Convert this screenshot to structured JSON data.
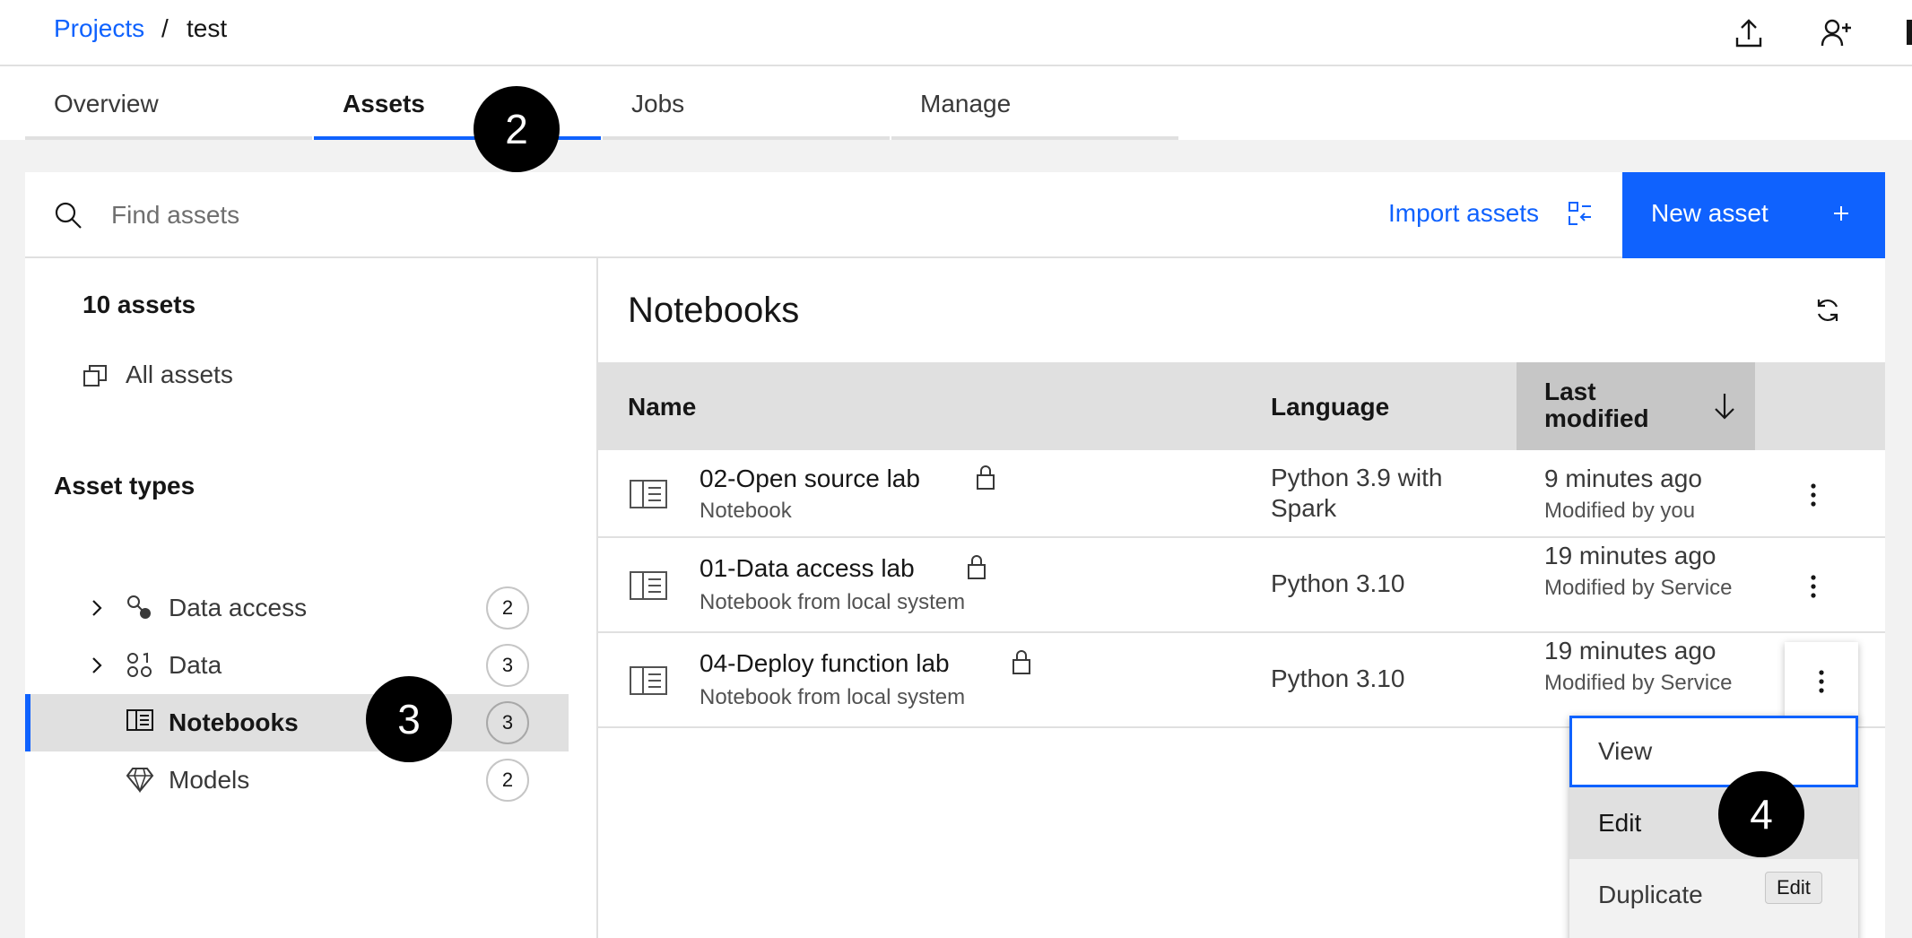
{
  "breadcrumb": {
    "root": "Projects",
    "separator": "/",
    "current": "test"
  },
  "header_icons": [
    "upload-icon",
    "add-user-icon"
  ],
  "tabs": [
    {
      "label": "Overview",
      "active": false
    },
    {
      "label": "Assets",
      "active": true
    },
    {
      "label": "Jobs",
      "active": false
    },
    {
      "label": "Manage",
      "active": false
    }
  ],
  "search": {
    "placeholder": "Find assets",
    "value": ""
  },
  "toolbar": {
    "import_label": "Import assets",
    "new_asset_label": "New asset"
  },
  "sidebar": {
    "count_label": "10 assets",
    "all_assets_label": "All assets",
    "asset_types_title": "Asset types",
    "types": [
      {
        "label": "Data access",
        "count": "2",
        "icon": "data-access-icon",
        "expandable": true,
        "selected": false
      },
      {
        "label": "Data",
        "count": "3",
        "icon": "data-icon",
        "expandable": true,
        "selected": false
      },
      {
        "label": "Notebooks",
        "count": "3",
        "icon": "notebook-icon",
        "expandable": false,
        "selected": true
      },
      {
        "label": "Models",
        "count": "2",
        "icon": "model-icon",
        "expandable": false,
        "selected": false
      }
    ]
  },
  "main": {
    "title": "Notebooks",
    "columns": {
      "name": "Name",
      "language": "Language",
      "modified": "Last modified"
    },
    "sort": {
      "column": "modified",
      "direction": "descending"
    },
    "rows": [
      {
        "name": "02-Open source lab",
        "sub": "Notebook",
        "language": "Python 3.9 with Spark",
        "time": "9 minutes ago",
        "by": "Modified by you"
      },
      {
        "name": "01-Data access lab",
        "sub": "Notebook from local system",
        "language": "Python 3.10",
        "time": "19 minutes ago",
        "by": "Modified by Service"
      },
      {
        "name": "04-Deploy function lab",
        "sub": "Notebook from local system",
        "language": "Python 3.10",
        "time": "19 minutes ago",
        "by": "Modified by Service"
      }
    ]
  },
  "menu": {
    "items": [
      "View",
      "Edit",
      "Duplicate"
    ],
    "tooltip": "Edit"
  },
  "callouts": [
    "2",
    "3",
    "4"
  ],
  "colors": {
    "accent": "#0f62fe",
    "selected_bg": "#e0e0e0",
    "callout": "#000000"
  }
}
